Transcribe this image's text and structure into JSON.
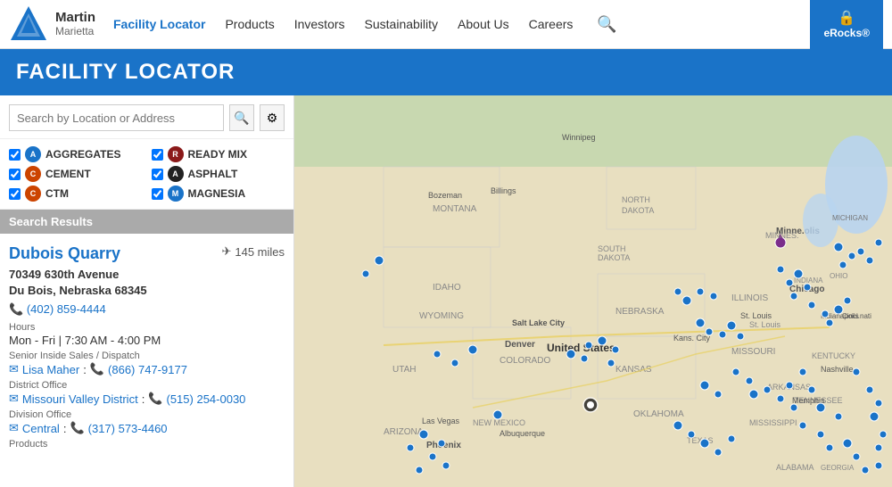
{
  "header": {
    "logo_name": "Martin",
    "logo_sub": "Marietta",
    "nav_items": [
      {
        "label": "Facility Locator",
        "active": true
      },
      {
        "label": "Products",
        "active": false
      },
      {
        "label": "Investors",
        "active": false
      },
      {
        "label": "Sustainability",
        "active": false
      },
      {
        "label": "About Us",
        "active": false
      },
      {
        "label": "Careers",
        "active": false
      }
    ],
    "erocks_label": "eRocks®"
  },
  "page_title": "FACILITY LOCATOR",
  "search": {
    "placeholder": "Search by Location or Address"
  },
  "filters": [
    {
      "id": "agg",
      "label": "AGGREGATES",
      "checked": true,
      "icon_class": "icon-agg"
    },
    {
      "id": "ready",
      "label": "READY MIX",
      "checked": true,
      "icon_class": "icon-ready"
    },
    {
      "id": "cement",
      "label": "CEMENT",
      "checked": true,
      "icon_class": "icon-cement"
    },
    {
      "id": "asphalt",
      "label": "ASPHALT",
      "checked": true,
      "icon_class": "icon-asphalt"
    },
    {
      "id": "ctm",
      "label": "CTM",
      "checked": true,
      "icon_class": "icon-ctm"
    },
    {
      "id": "magnesia",
      "label": "MAGNESIA",
      "checked": true,
      "icon_class": "icon-magnesia"
    }
  ],
  "search_results_header": "Search Results",
  "result": {
    "name": "Dubois Quarry",
    "distance": "145 miles",
    "address_line1": "70349 630th Avenue",
    "address_line2": "Du Bois, Nebraska 68345",
    "phone": "(402) 859-4444",
    "hours_label": "Hours",
    "hours_value": "Mon - Fri | 7:30 AM - 4:00 PM",
    "senior_label": "Senior Inside Sales / Dispatch",
    "senior_name": "Lisa Maher",
    "senior_phone": "(866) 747-9177",
    "district_label": "District Office",
    "district_name": "Missouri Valley District",
    "district_phone": "(515) 254-0030",
    "division_label": "Division Office",
    "division_name": "Central",
    "division_phone": "(317) 573-4460",
    "products_label": "Products"
  }
}
